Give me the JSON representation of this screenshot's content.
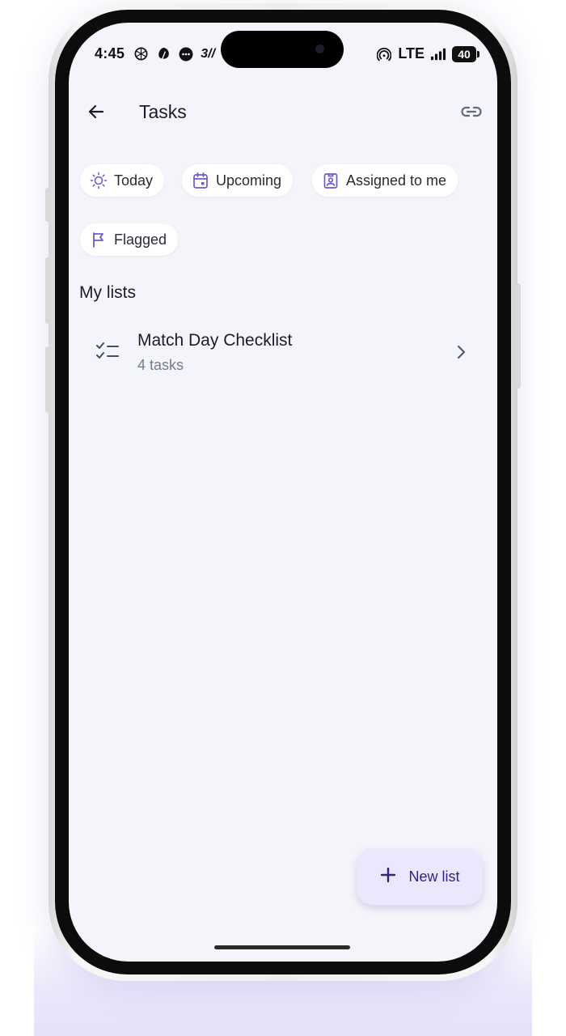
{
  "status_bar": {
    "time": "4:45",
    "carrier_badge": "3//",
    "network": "LTE",
    "battery": "40",
    "left_icons": [
      "openai-icon",
      "leaf-icon",
      "chat-bubble-icon"
    ],
    "right_icons": [
      "hotspot-icon",
      "signal-bars-icon"
    ]
  },
  "header": {
    "title": "Tasks",
    "back_icon": "arrow-left-icon",
    "link_icon": "link-icon"
  },
  "filters": [
    {
      "label": "Today",
      "icon": "sun-icon"
    },
    {
      "label": "Upcoming",
      "icon": "calendar-icon"
    },
    {
      "label": "Assigned to me",
      "icon": "badge-icon"
    },
    {
      "label": "Flagged",
      "icon": "flag-icon"
    }
  ],
  "my_lists": {
    "title": "My lists",
    "items": [
      {
        "name": "Match Day Checklist",
        "count": "4 tasks",
        "icon": "checklist-icon"
      }
    ]
  },
  "fab": {
    "label": "New list",
    "icon": "plus-icon"
  },
  "colors": {
    "accent": "#6a5acd",
    "screen_bg": "#f4f5fa",
    "fab_bg": "#ebe7fc",
    "fab_text": "#2d2580"
  }
}
